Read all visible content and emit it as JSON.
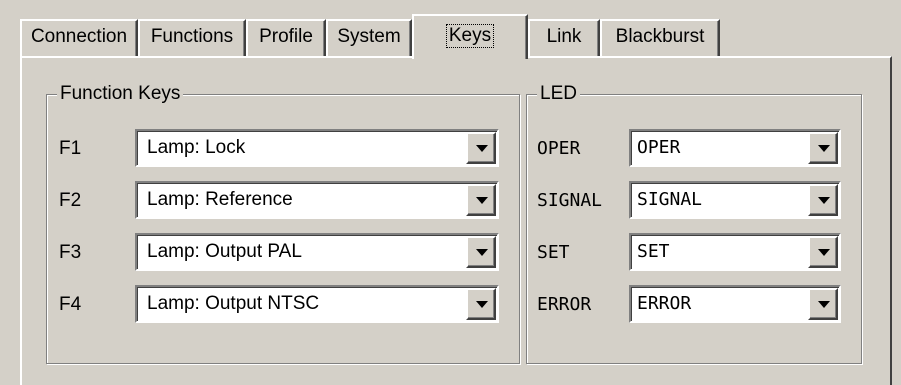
{
  "tabs": [
    {
      "label": "Connection",
      "active": false
    },
    {
      "label": "Functions",
      "active": false
    },
    {
      "label": "Profile",
      "active": false
    },
    {
      "label": "System",
      "active": false
    },
    {
      "label": "Keys",
      "active": true
    },
    {
      "label": "Link",
      "active": false
    },
    {
      "label": "Blackburst",
      "active": false
    }
  ],
  "function_keys": {
    "title": "Function Keys",
    "rows": [
      {
        "key": "F1",
        "value": "Lamp: Lock"
      },
      {
        "key": "F2",
        "value": "Lamp: Reference"
      },
      {
        "key": "F3",
        "value": "Lamp: Output PAL"
      },
      {
        "key": "F4",
        "value": "Lamp: Output NTSC"
      }
    ]
  },
  "led": {
    "title": "LED",
    "rows": [
      {
        "label": "OPER",
        "value": "OPER"
      },
      {
        "label": "SIGNAL",
        "value": "SIGNAL"
      },
      {
        "label": "SET",
        "value": "SET"
      },
      {
        "label": "ERROR",
        "value": "ERROR"
      }
    ]
  },
  "icons": {
    "dropdown": "chevron-down-icon"
  }
}
